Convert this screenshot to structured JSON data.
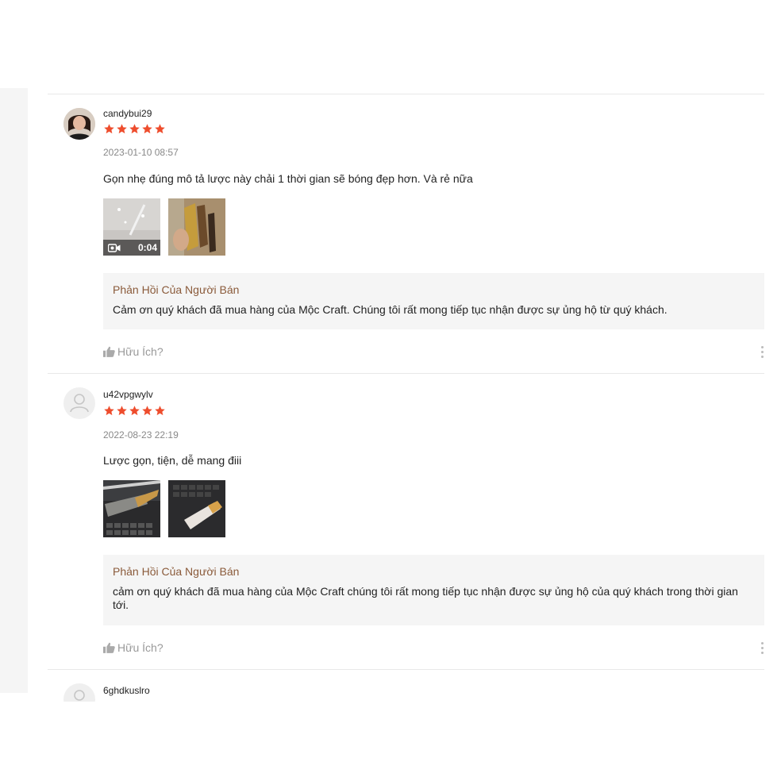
{
  "reviews": [
    {
      "username": "candybui29",
      "rating": 5,
      "date": "2023-01-10 08:57",
      "comment": "Gọn nhẹ đúng mô tả lược này chải 1 thời gian sẽ bóng đẹp hơn. Và rẻ nữa",
      "video_duration": "0:04",
      "seller_reply_title": "Phản Hồi Của Người Bán",
      "seller_reply": "Cảm ơn quý khách đã mua hàng của Mộc Craft. Chúng tôi rất mong tiếp tục nhận được sự ủng hộ từ quý khách.",
      "helpful_label": "Hữu Ích?"
    },
    {
      "username": "u42vpgwylv",
      "rating": 5,
      "date": "2022-08-23 22:19",
      "comment": "Lược gọn, tiện, dễ mang điii",
      "seller_reply_title": "Phản Hồi Của Người Bán",
      "seller_reply": "cảm ơn quý khách đã mua hàng của Mộc Craft chúng tôi rất mong tiếp tục nhận được sự ủng hộ của quý khách trong thời gian tới.",
      "helpful_label": "Hữu Ích?"
    },
    {
      "username": "6ghdkuslro"
    }
  ],
  "colors": {
    "star": "#ee4d2d",
    "seller_title": "#8a5a3a",
    "muted": "#999999"
  },
  "icons": {
    "video": "video-camera-icon",
    "helpful": "thumbs-up-icon",
    "more": "more-vertical-icon"
  }
}
